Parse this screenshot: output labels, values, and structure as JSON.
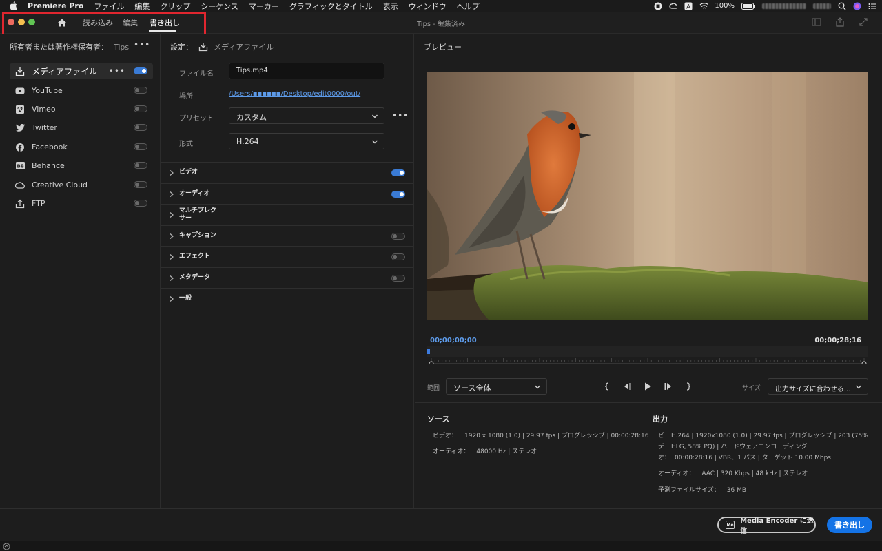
{
  "menubar": {
    "app_name": "Premiere Pro",
    "items": [
      "ファイル",
      "編集",
      "クリップ",
      "シーケンス",
      "マーカー",
      "グラフィックとタイトル",
      "表示",
      "ウィンドウ",
      "ヘルプ"
    ],
    "battery": "100%"
  },
  "titlebar": {
    "tabs": {
      "import": "読み込み",
      "edit": "編集",
      "export": "書き出し"
    },
    "window_title": "Tips - 編集済み"
  },
  "left_panel": {
    "owner_label": "所有者または著作権保有者：",
    "owner_value": "Tips",
    "more": "•••",
    "destinations": [
      {
        "label": "メディアファイル",
        "icon": "download-icon",
        "enabled": true
      },
      {
        "label": "YouTube",
        "icon": "youtube-icon",
        "enabled": false
      },
      {
        "label": "Vimeo",
        "icon": "vimeo-icon",
        "enabled": false
      },
      {
        "label": "Twitter",
        "icon": "twitter-icon",
        "enabled": false
      },
      {
        "label": "Facebook",
        "icon": "facebook-icon",
        "enabled": false
      },
      {
        "label": "Behance",
        "icon": "behance-icon",
        "enabled": false
      },
      {
        "label": "Creative Cloud",
        "icon": "creative-cloud-icon",
        "enabled": false
      },
      {
        "label": "FTP",
        "icon": "upload-icon",
        "enabled": false
      }
    ]
  },
  "settings": {
    "heading": "設定：",
    "heading_sub": "メディアファイル",
    "filename_label": "ファイル名",
    "filename_value": "Tips.mp4",
    "location_label": "場所",
    "location_value": "/Users/▪▪▪▪▪▪/Desktop/edit0000/out/",
    "preset_label": "プリセット",
    "preset_value": "カスタム",
    "more": "•••",
    "format_label": "形式",
    "format_value": "H.264",
    "sections": [
      {
        "label": "ビデオ",
        "toggle": "on"
      },
      {
        "label": "オーディオ",
        "toggle": "on"
      },
      {
        "label": "マルチプレクサー",
        "toggle": "none"
      },
      {
        "label": "キャプション",
        "toggle": "off"
      },
      {
        "label": "エフェクト",
        "toggle": "off"
      },
      {
        "label": "メタデータ",
        "toggle": "off"
      },
      {
        "label": "一般",
        "toggle": "none"
      }
    ]
  },
  "preview": {
    "title": "プレビュー",
    "timecode_start": "00;00;00;00",
    "timecode_end": "00;00;28;16",
    "range_label": "範囲",
    "range_value": "ソース全体",
    "size_label": "サイズ",
    "size_value": "出力サイズに合わせる…",
    "playhead_fraction": 0
  },
  "source_info": {
    "title": "ソース",
    "video_label": "ビデオ：",
    "video_value": "1920 x 1080 (1.0)  |  29.97 fps  |  プログレッシブ  |  00:00:28:16",
    "audio_label": "オーディオ：",
    "audio_value": "48000 Hz  |  ステレオ"
  },
  "output_info": {
    "title": "出力",
    "video_label_1": "ビ",
    "video_line_1": "H.264  |  1920x1080 (1.0)  |  29.97 fps  |  プログレッシブ  |  203 (75%",
    "video_label_2": "デ",
    "video_line_2": "HLG, 58% PQ)  |  ハードウェアエンコーディング",
    "video_label_3": "オ：",
    "video_line_3": "00:00:28:16  |  VBR、1 パス  |  ターゲット 10.00 Mbps",
    "audio_label": "オーディオ：",
    "audio_value": "AAC  |  320 Kbps  |  48 kHz  |  ステレオ",
    "size_label": "予測ファイルサイズ：",
    "size_value": "36 MB"
  },
  "bottom": {
    "media_encoder_label": "Media Encoder に送信",
    "me_badge": "Me",
    "export_label": "書き出し"
  },
  "colors": {
    "accent": "#1473e6",
    "highlight": "#e0262f",
    "link": "#5d9bea"
  }
}
